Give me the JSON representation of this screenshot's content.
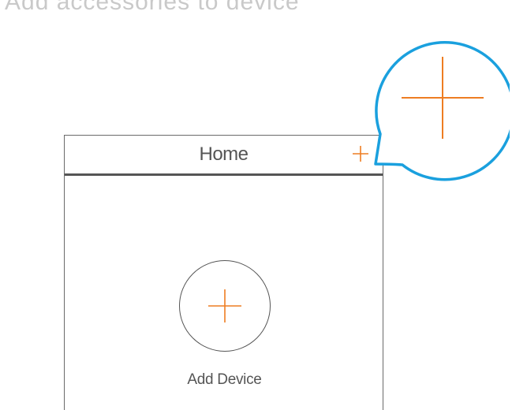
{
  "caption": {
    "text": "Add accessories to device"
  },
  "header": {
    "title": "Home",
    "plus_icon": "plus-icon"
  },
  "main": {
    "add_device_label": "Add Device",
    "add_device_icon": "plus-icon"
  },
  "callout": {
    "icon": "plus-icon"
  },
  "colors": {
    "accent": "#ee7d22",
    "callout_border": "#1aa0de",
    "frame": "#555555",
    "caption": "#c9c9c9"
  }
}
